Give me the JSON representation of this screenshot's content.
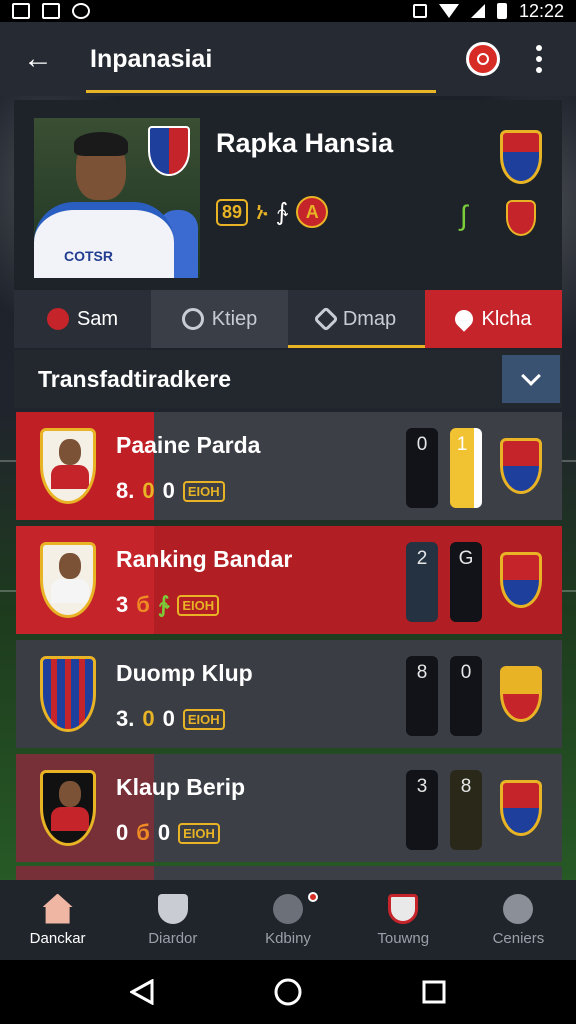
{
  "status_bar": {
    "time": "12:22"
  },
  "app_bar": {
    "title": "Inpanasiai"
  },
  "profile": {
    "name": "Rapka Hansia",
    "photo_shirt_text": "COTSR",
    "stat_badge": "89",
    "stat_glyphs": [
      "ኑ",
      "∱"
    ],
    "stat_circle": "A"
  },
  "tabs": [
    {
      "label": "Sam"
    },
    {
      "label": "Ktiep"
    },
    {
      "label": "Dmap"
    },
    {
      "label": "Klcha"
    }
  ],
  "section": {
    "title": "Transfadtiradkere"
  },
  "matches": [
    {
      "team": "Paaine Parda",
      "stat1": "8.",
      "stat2": "0",
      "stat3": "0",
      "badge": "EIOH",
      "score_a": "0",
      "score_b": "1"
    },
    {
      "team": "Ranking Bandar",
      "stat1": "3",
      "stat2": "б",
      "stat3": "∱",
      "badge": "EIOH",
      "score_a": "2",
      "score_b": "G"
    },
    {
      "team": "Duomp Klup",
      "stat1": "3.",
      "stat2": "0",
      "stat3": "0",
      "badge": "EIOH",
      "score_a": "8",
      "score_b": "0"
    },
    {
      "team": "Klaup Berip",
      "stat1": "0",
      "stat2": "б",
      "stat3": "0",
      "badge": "EIOH",
      "score_a": "3",
      "score_b": "8"
    }
  ],
  "bottom_nav": [
    {
      "label": "Danckar"
    },
    {
      "label": "Diardor"
    },
    {
      "label": "Kdbiny"
    },
    {
      "label": "Touwng"
    },
    {
      "label": "Ceniers"
    }
  ],
  "colors": {
    "accent_red": "#c5242b",
    "accent_yellow": "#e8b325",
    "app_bar": "#262a33"
  }
}
